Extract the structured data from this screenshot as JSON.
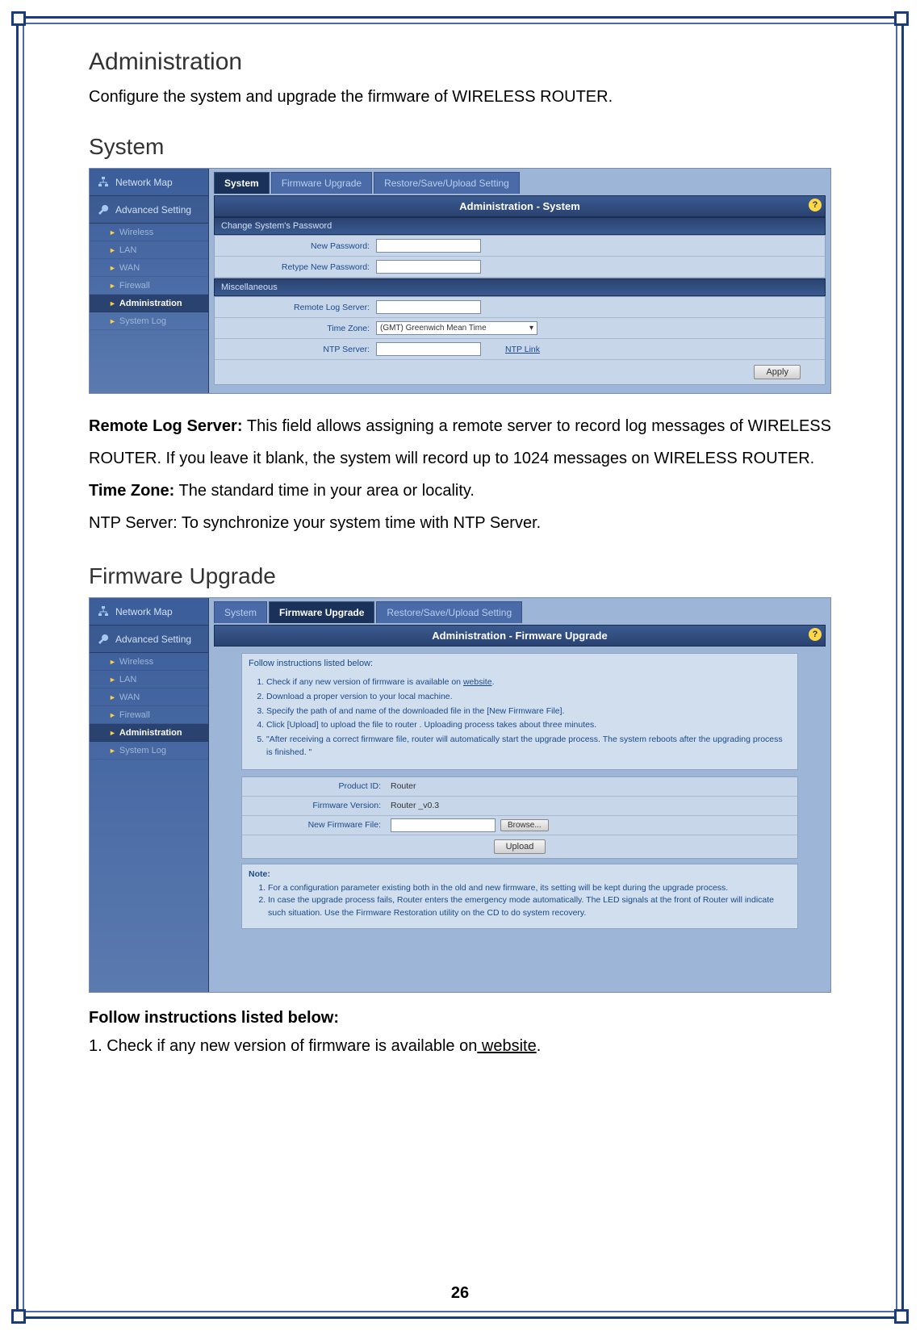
{
  "page_number": "26",
  "doc": {
    "h1": "Administration",
    "intro": "Configure the system and upgrade the firmware of WIRELESS ROUTER.",
    "h2_system": "System",
    "h2_firmware": "Firmware Upgrade",
    "remote_log_label": "Remote Log Server:",
    "remote_log_text": " This field allows assigning a remote server to record log messages of WIRELESS ROUTER. If you leave it blank, the system will record up to 1024 messages on WIRELESS ROUTER.",
    "timezone_label": "Time Zone:",
    "timezone_text": " The standard time in your area or locality.",
    "ntp_text": "NTP Server: To synchronize your system time with NTP Server.",
    "follow_head": "Follow instructions listed below:",
    "follow_1_pre": "1. Check if any new version of firmware is available on",
    "follow_1_link": " website",
    "follow_1_post": "."
  },
  "shot1": {
    "sidebar": {
      "top1": "Network Map",
      "top2": "Advanced Setting",
      "items": [
        "Wireless",
        "LAN",
        "WAN",
        "Firewall",
        "Administration",
        "System Log"
      ],
      "active_index": 4
    },
    "tabs": [
      "System",
      "Firmware Upgrade",
      "Restore/Save/Upload Setting"
    ],
    "active_tab": 0,
    "title": "Administration - System",
    "section1": "Change System's Password",
    "new_pw": "New Password:",
    "retype_pw": "Retype New Password:",
    "section2": "Miscellaneous",
    "remote_log": "Remote Log Server:",
    "timezone_lbl": "Time Zone:",
    "timezone_val": "(GMT) Greenwich Mean Time",
    "ntp_lbl": "NTP Server:",
    "ntp_link": "NTP Link",
    "apply": "Apply"
  },
  "shot2": {
    "sidebar": {
      "top1": "Network Map",
      "top2": "Advanced Setting",
      "items": [
        "Wireless",
        "LAN",
        "WAN",
        "Firewall",
        "Administration",
        "System Log"
      ],
      "active_index": 4
    },
    "tabs": [
      "System",
      "Firmware Upgrade",
      "Restore/Save/Upload Setting"
    ],
    "active_tab": 1,
    "title": "Administration - Firmware Upgrade",
    "instr_head": "Follow instructions listed below:",
    "instr": [
      "Check if any new version of firmware is available on website.",
      "Download a proper version to your local machine.",
      "Specify the path of and name of the downloaded file in the [New Firmware File].",
      "Click [Upload] to upload the file to router . Uploading process takes about three minutes.",
      "\"After receiving a correct firmware file, router   will automatically start the upgrade process. The system reboots after the upgrading process is finished. \""
    ],
    "website_link": "website",
    "product_id_lbl": "Product ID:",
    "product_id_val": "Router",
    "fw_ver_lbl": "Firmware Version:",
    "fw_ver_val": "Router _v0.3",
    "new_fw_lbl": "New Firmware File:",
    "browse": "Browse...",
    "upload": "Upload",
    "note_head": "Note:",
    "notes": [
      "For a configuration parameter existing both in the old and new firmware, its setting will be kept during the upgrade process.",
      "In case the upgrade process fails, Router   enters the emergency mode automatically. The LED signals at the front of Router   will indicate such situation. Use the Firmware Restoration utility on the CD to do system recovery."
    ]
  }
}
